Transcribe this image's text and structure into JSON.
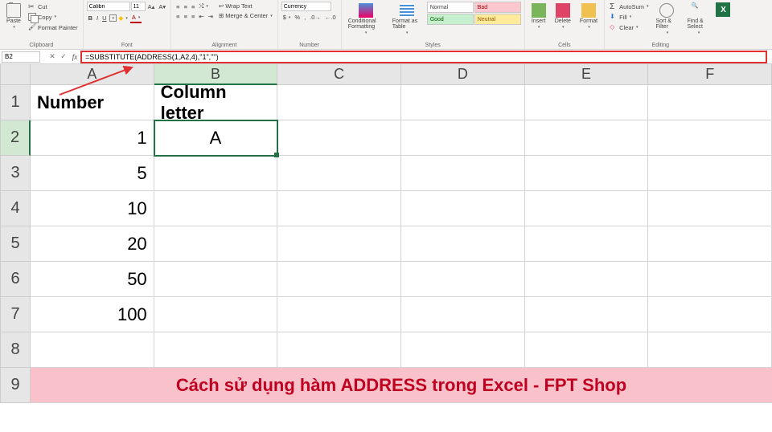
{
  "ribbon": {
    "clipboard": {
      "paste": "Paste",
      "cut": "Cut",
      "copy": "Copy",
      "painter": "Format Painter",
      "label": "Clipboard"
    },
    "font": {
      "name": "Calibri",
      "size": "11",
      "label": "Font"
    },
    "alignment": {
      "wrap": "Wrap Text",
      "merge": "Merge & Center",
      "label": "Alignment"
    },
    "number": {
      "format": "Currency",
      "label": "Number"
    },
    "styles": {
      "cond": "Conditional Formatting",
      "table": "Format as Table",
      "normal": "Normal",
      "bad": "Bad",
      "good": "Good",
      "neutral": "Neutral",
      "label": "Styles"
    },
    "cells": {
      "insert": "Insert",
      "delete": "Delete",
      "format": "Format",
      "label": "Cells"
    },
    "editing": {
      "sum": "AutoSum",
      "fill": "Fill",
      "clear": "Clear",
      "sort": "Sort & Filter",
      "find": "Find & Select",
      "label": "Editing"
    }
  },
  "formula_bar": {
    "cell_ref": "B2",
    "formula": "=SUBSTITUTE(ADDRESS(1,A2,4),\"1\",\"\")"
  },
  "columns": [
    "A",
    "B",
    "C",
    "D",
    "E",
    "F"
  ],
  "rows": [
    {
      "n": "1",
      "a": "Number",
      "b": "Column letter"
    },
    {
      "n": "2",
      "a": "1",
      "b": "A"
    },
    {
      "n": "3",
      "a": "5",
      "b": ""
    },
    {
      "n": "4",
      "a": "10",
      "b": ""
    },
    {
      "n": "5",
      "a": "20",
      "b": ""
    },
    {
      "n": "6",
      "a": "50",
      "b": ""
    },
    {
      "n": "7",
      "a": "100",
      "b": ""
    },
    {
      "n": "8",
      "a": "",
      "b": ""
    }
  ],
  "banner": {
    "n": "9",
    "text": "Cách sử dụng hàm ADDRESS trong Excel - FPT Shop"
  },
  "active_cell": "B2"
}
